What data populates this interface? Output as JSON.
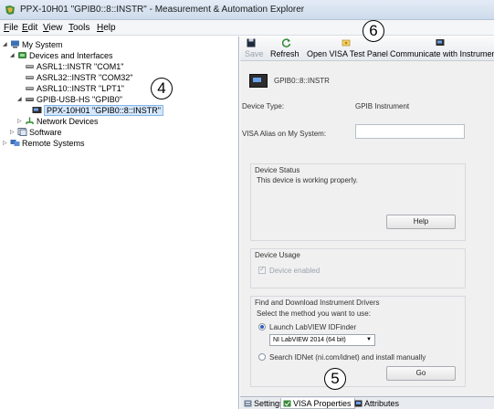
{
  "window": {
    "title": "PPX-10H01 \"GPIB0::8::INSTR\" - Measurement & Automation Explorer"
  },
  "menu": [
    {
      "mnemonic": "F",
      "rest": "ile"
    },
    {
      "mnemonic": "E",
      "rest": "dit"
    },
    {
      "mnemonic": "V",
      "rest": "iew"
    },
    {
      "mnemonic": "T",
      "rest": "ools"
    },
    {
      "mnemonic": "H",
      "rest": "elp"
    }
  ],
  "tree": [
    {
      "label": "My System",
      "expander": "◢",
      "icon": "computer-icon"
    },
    {
      "label": "Devices and Interfaces",
      "expander": "◢",
      "icon": "devices-icon"
    },
    {
      "label": "ASRL1::INSTR \"COM1\"",
      "expander": "",
      "icon": "serial-port-icon"
    },
    {
      "label": "ASRL32::INSTR \"COM32\"",
      "expander": "",
      "icon": "serial-port-icon"
    },
    {
      "label": "ASRL10::INSTR \"LPT1\"",
      "expander": "",
      "icon": "serial-port-icon"
    },
    {
      "label": "GPIB-USB-HS \"GPIB0\"",
      "expander": "◢",
      "icon": "gpib-interface-icon"
    },
    {
      "label": "PPX-10H01 \"GPIB0::8::INSTR\"",
      "expander": "",
      "icon": "instrument-icon"
    },
    {
      "label": "Network Devices",
      "expander": "▷",
      "icon": "network-icon"
    },
    {
      "label": "Software",
      "expander": "▷",
      "icon": "software-icon"
    },
    {
      "label": "Remote Systems",
      "expander": "▷",
      "icon": "remote-systems-icon"
    }
  ],
  "toolbar": {
    "save": "Save",
    "refresh": "Refresh",
    "open_visa": "Open VISA Test Panel",
    "communicate": "Communicate with Instrument"
  },
  "details": {
    "resource_name": "GPIB0::8::INSTR",
    "device_type_label": "Device Type:",
    "device_type_value": "GPIB Instrument",
    "alias_label": "VISA Alias on My System:",
    "alias_value": "",
    "status_title": "Device Status",
    "status_text": "This device is working properly.",
    "help_button": "Help",
    "usage_title": "Device Usage",
    "device_enabled": "Device enabled",
    "drivers_title": "Find and Download Instrument Drivers",
    "method_prompt": "Select the method you want to use:",
    "option_labview": "Launch LabVIEW IDFinder",
    "labview_version": "NI LabVIEW 2014 (64 bit)",
    "option_idnet": "Search IDNet (ni.com/idnet) and install manually",
    "go_button": "Go"
  },
  "tabs": {
    "settings": "Settings",
    "visa_properties": "VISA Properties",
    "attributes": "Attributes"
  },
  "callouts": {
    "c4": "4",
    "c5": "5",
    "c6": "6"
  },
  "colors": {
    "selection": "#d3e6fb",
    "accent": "#2b5fb8"
  }
}
